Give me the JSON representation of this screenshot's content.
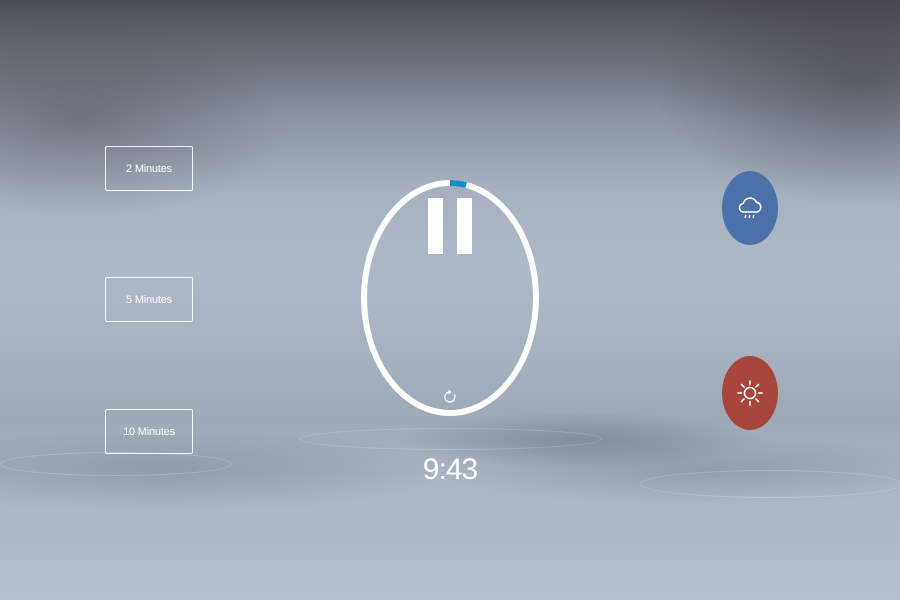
{
  "presets": [
    {
      "label": "2 Minutes"
    },
    {
      "label": "5 Minutes"
    },
    {
      "label": "10 Minutes"
    }
  ],
  "timer": {
    "display": "9:43",
    "progress_fraction": 0.03,
    "state": "running",
    "ring_color": "#ffffff",
    "progress_color": "#1e8bc3",
    "pause_icon": "pause-icon",
    "reset_icon": "reset-icon"
  },
  "sounds": [
    {
      "icon": "rain-cloud-icon",
      "color": "#4a72a8"
    },
    {
      "icon": "sun-icon",
      "color": "#a8453b"
    }
  ]
}
